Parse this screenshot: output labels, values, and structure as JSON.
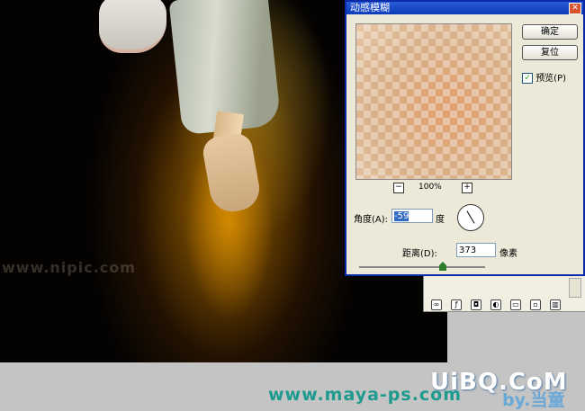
{
  "dialog": {
    "title": "动感模糊",
    "close_glyph": "✕",
    "ok_label": "确定",
    "reset_label": "复位",
    "preview_label": "预览(P)",
    "preview_checked": true,
    "zoom_level": "100%",
    "zoom_minus": "−",
    "zoom_plus": "+",
    "angle_label": "角度(A):",
    "angle_value": "-59",
    "angle_unit": "度",
    "distance_label": "距离(D):",
    "distance_value": "373",
    "distance_unit": "像素"
  },
  "canvas": {
    "watermark": "www.nipic.com"
  },
  "layers_panel": {
    "tools": [
      "link-icon",
      "fx-icon",
      "mask-icon",
      "adjustment-icon",
      "folder-icon",
      "new-layer-icon",
      "trash-icon"
    ]
  },
  "footer": {
    "url": "www.maya-ps.com",
    "author": "by.当童",
    "logo": "UiBQ.CoM"
  }
}
